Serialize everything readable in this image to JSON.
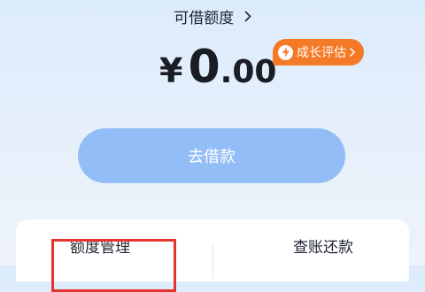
{
  "credit": {
    "title": "可借额度",
    "currency_symbol": "¥",
    "amount_integer": "0",
    "amount_decimal": ".00"
  },
  "growth_badge": {
    "label": "成长评估",
    "icon": "lightning-icon"
  },
  "borrow_button": {
    "label": "去借款"
  },
  "bottom_tabs": [
    {
      "label": "额度管理",
      "highlighted": true
    },
    {
      "label": "查账还款",
      "highlighted": false
    }
  ],
  "colors": {
    "button": "#93bdf6",
    "badge": "#f57a27",
    "highlight_border": "#e5342f"
  }
}
